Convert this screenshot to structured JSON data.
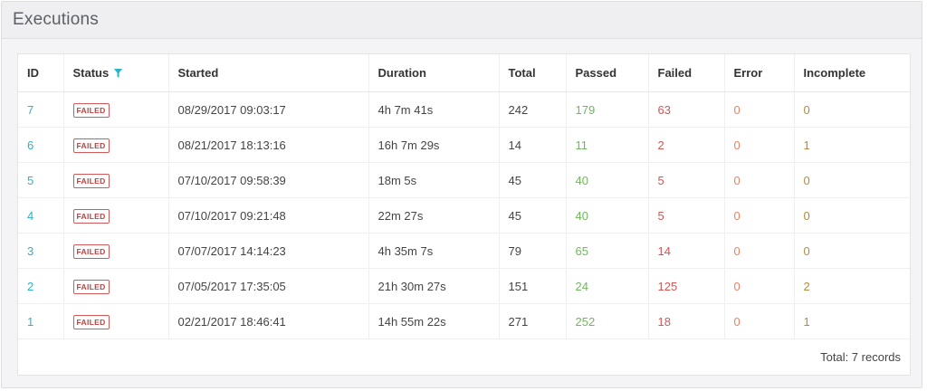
{
  "panel": {
    "title": "Executions"
  },
  "table": {
    "columns": [
      "ID",
      "Status",
      "Started",
      "Duration",
      "Total",
      "Passed",
      "Failed",
      "Error",
      "Incomplete"
    ],
    "rows": [
      {
        "id": "7",
        "status": "FAILED",
        "started": "08/29/2017 09:03:17",
        "duration": "4h 7m 41s",
        "total": "242",
        "passed": "179",
        "failed": "63",
        "error": "0",
        "incomplete": "0"
      },
      {
        "id": "6",
        "status": "FAILED",
        "started": "08/21/2017 18:13:16",
        "duration": "16h 7m 29s",
        "total": "14",
        "passed": "11",
        "failed": "2",
        "error": "0",
        "incomplete": "1"
      },
      {
        "id": "5",
        "status": "FAILED",
        "started": "07/10/2017 09:58:39",
        "duration": "18m 5s",
        "total": "45",
        "passed": "40",
        "failed": "5",
        "error": "0",
        "incomplete": "0"
      },
      {
        "id": "4",
        "status": "FAILED",
        "started": "07/10/2017 09:21:48",
        "duration": "22m 27s",
        "total": "45",
        "passed": "40",
        "failed": "5",
        "error": "0",
        "incomplete": "0"
      },
      {
        "id": "3",
        "status": "FAILED",
        "started": "07/07/2017 14:14:23",
        "duration": "4h 35m 7s",
        "total": "79",
        "passed": "65",
        "failed": "14",
        "error": "0",
        "incomplete": "0"
      },
      {
        "id": "2",
        "status": "FAILED",
        "started": "07/05/2017 17:35:05",
        "duration": "21h 30m 27s",
        "total": "151",
        "passed": "24",
        "failed": "125",
        "error": "0",
        "incomplete": "2"
      },
      {
        "id": "1",
        "status": "FAILED",
        "started": "02/21/2017 18:46:41",
        "duration": "14h 55m 22s",
        "total": "271",
        "passed": "252",
        "failed": "18",
        "error": "0",
        "incomplete": "1"
      }
    ]
  },
  "footer": {
    "total_text": "Total: 7 records"
  },
  "icons": {
    "status_filter": "filter-icon"
  },
  "colors": {
    "link": "#2ab4c9",
    "passed": "#6fb85b",
    "failed": "#d05656",
    "error": "#e8836a",
    "incomplete": "#b48b3c",
    "badge": "#c93c3c",
    "filter": "#2ab4c9"
  }
}
